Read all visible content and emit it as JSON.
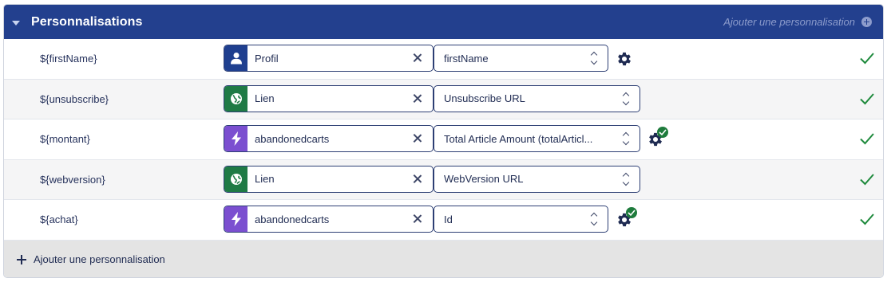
{
  "header": {
    "title": "Personnalisations",
    "add_label": "Ajouter une personnalisation"
  },
  "rows": [
    {
      "variable": "${firstName}",
      "source": {
        "label": "Profil",
        "icon": "user-icon"
      },
      "field": "firstName",
      "configured": false
    },
    {
      "variable": "${unsubscribe}",
      "source": {
        "label": "Lien",
        "icon": "globe-icon"
      },
      "field": "Unsubscribe URL",
      "configured": null
    },
    {
      "variable": "${montant}",
      "source": {
        "label": "abandonedcarts",
        "icon": "lightning-icon"
      },
      "field": "Total Article Amount (totalArticl...",
      "configured": true
    },
    {
      "variable": "${webversion}",
      "source": {
        "label": "Lien",
        "icon": "globe-icon"
      },
      "field": "WebVersion URL",
      "configured": null
    },
    {
      "variable": "${achat}",
      "source": {
        "label": "abandonedcarts",
        "icon": "lightning-icon"
      },
      "field": "Id",
      "configured": true
    }
  ],
  "footer": {
    "add_label": "Ajouter une personnalisation"
  },
  "colors": {
    "header_bg": "#23408e",
    "profil": "#1f3f8f",
    "lien": "#1f7a45",
    "event": "#7b4fd0",
    "valid": "#1e8a3c"
  }
}
